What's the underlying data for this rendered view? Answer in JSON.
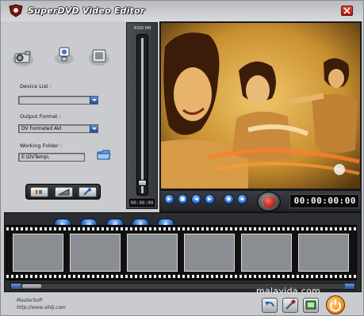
{
  "title_bar": {
    "app_title": "SuperDVD Video Editor",
    "close_icon": "close-icon"
  },
  "top_tools": [
    {
      "name": "camera-icon"
    },
    {
      "name": "webcam-icon"
    },
    {
      "name": "tv-capture-icon"
    }
  ],
  "settings": {
    "device_list_label": "Device List :",
    "device_list_value": "",
    "output_format_label": "Output Format :",
    "output_format_value": "DV Formated AVI",
    "working_folder_label": "Working Folder :",
    "working_folder_value": "E:\\DVTemp\\"
  },
  "tool_strip": [
    "color-bars-icon",
    "volume-slope-icon",
    "microphone-icon"
  ],
  "volume": {
    "label": "4300 MB",
    "counter": "00:00:00",
    "level": 0.08
  },
  "transport": {
    "buttons": [
      "play",
      "stop",
      "rewind",
      "forward",
      "capture",
      "settings"
    ],
    "timecode": "00:00:00:00"
  },
  "strip_controls": [
    "move-left-icon",
    "move-right-icon",
    "swap-icon",
    "delete-icon",
    "properties-icon"
  ],
  "film_frames": 6,
  "footer": {
    "company": "MasterSoft",
    "url": "http://www.alldj.com",
    "watermark": "malavida.com"
  },
  "colors": {
    "window_bg": "#c9cbce",
    "dark_panel": "#2b2d31",
    "accent_blue": "#2460bb",
    "record_red": "#c21d12",
    "video_tint": "#d9a640"
  }
}
